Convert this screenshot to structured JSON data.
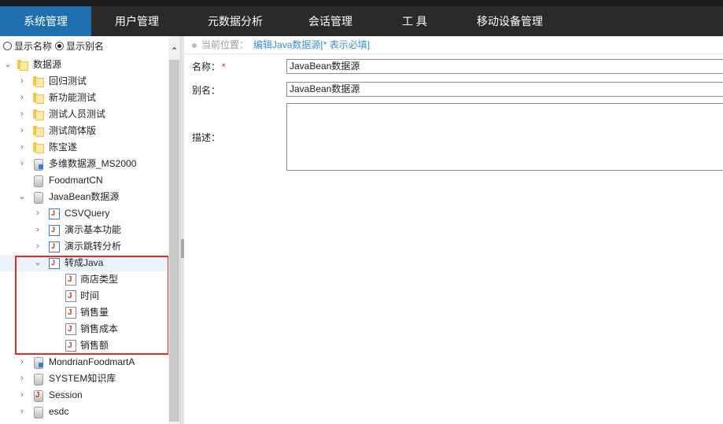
{
  "nav": {
    "items": [
      {
        "label": "系统管理",
        "active": true
      },
      {
        "label": "用户管理",
        "active": false
      },
      {
        "label": "元数据分析",
        "active": false
      },
      {
        "label": "会话管理",
        "active": false
      },
      {
        "label": "工 具",
        "active": false
      },
      {
        "label": "移动设备管理",
        "active": false
      }
    ]
  },
  "sidebar": {
    "display_options": [
      {
        "label": "显示名称",
        "checked": false
      },
      {
        "label": "显示别名",
        "checked": true
      }
    ],
    "tree": [
      {
        "label": "数据源",
        "icon": "folder-icon",
        "toggle": "expanded"
      },
      {
        "label": "回归测试",
        "icon": "folder-icon",
        "toggle": "collapsed"
      },
      {
        "label": "新功能测试",
        "icon": "folder-icon",
        "toggle": "collapsed"
      },
      {
        "label": "测试人员测试",
        "icon": "folder-icon",
        "toggle": "collapsed"
      },
      {
        "label": "测试简体版",
        "icon": "folder-icon",
        "toggle": "collapsed"
      },
      {
        "label": "陈宝遂",
        "icon": "folder-icon",
        "toggle": "collapsed"
      },
      {
        "label": "多维数据源_MS2000",
        "icon": "cube-database-icon",
        "toggle": "collapsed"
      },
      {
        "label": "FoodmartCN",
        "icon": "database-icon",
        "toggle": "none"
      },
      {
        "label": "JavaBean数据源",
        "icon": "database-icon",
        "toggle": "expanded"
      },
      {
        "label": "CSVQuery",
        "icon": "java-table-icon",
        "toggle": "collapsed"
      },
      {
        "label": "演示基本功能",
        "icon": "java-table-icon",
        "toggle": "collapsed"
      },
      {
        "label": "演示跳转分析",
        "icon": "java-table-icon",
        "toggle": "collapsed"
      },
      {
        "label": "转成Java",
        "icon": "java-table-icon",
        "toggle": "expanded"
      },
      {
        "label": "商店类型",
        "icon": "java-method-icon",
        "toggle": "none"
      },
      {
        "label": "时间",
        "icon": "java-method-icon",
        "toggle": "none"
      },
      {
        "label": "销售量",
        "icon": "java-method-icon",
        "toggle": "none"
      },
      {
        "label": "销售成本",
        "icon": "java-method-icon",
        "toggle": "none"
      },
      {
        "label": "销售额",
        "icon": "java-method-icon",
        "toggle": "none"
      },
      {
        "label": "MondrianFoodmartA",
        "icon": "cube-database-icon",
        "toggle": "collapsed"
      },
      {
        "label": "SYSTEM知识库",
        "icon": "database-icon",
        "toggle": "collapsed"
      },
      {
        "label": "Session",
        "icon": "java-database-icon",
        "toggle": "collapsed"
      },
      {
        "label": "esdc",
        "icon": "database-icon",
        "toggle": "collapsed"
      }
    ]
  },
  "breadcrumb": {
    "label": "当前位置：",
    "current": "编辑Java数据源[* 表示必填]"
  },
  "form": {
    "name_label": "名称：",
    "required_mark": "*",
    "name_value": "JavaBean数据源",
    "alias_label": "别名：",
    "alias_value": "JavaBean数据源",
    "description_label": "描述：",
    "description_value": ""
  },
  "colors": {
    "nav_bg": "#2a2a2a",
    "nav_active": "#1f6fae",
    "highlight_border": "#e12b2b",
    "link": "#3b8ed0"
  }
}
